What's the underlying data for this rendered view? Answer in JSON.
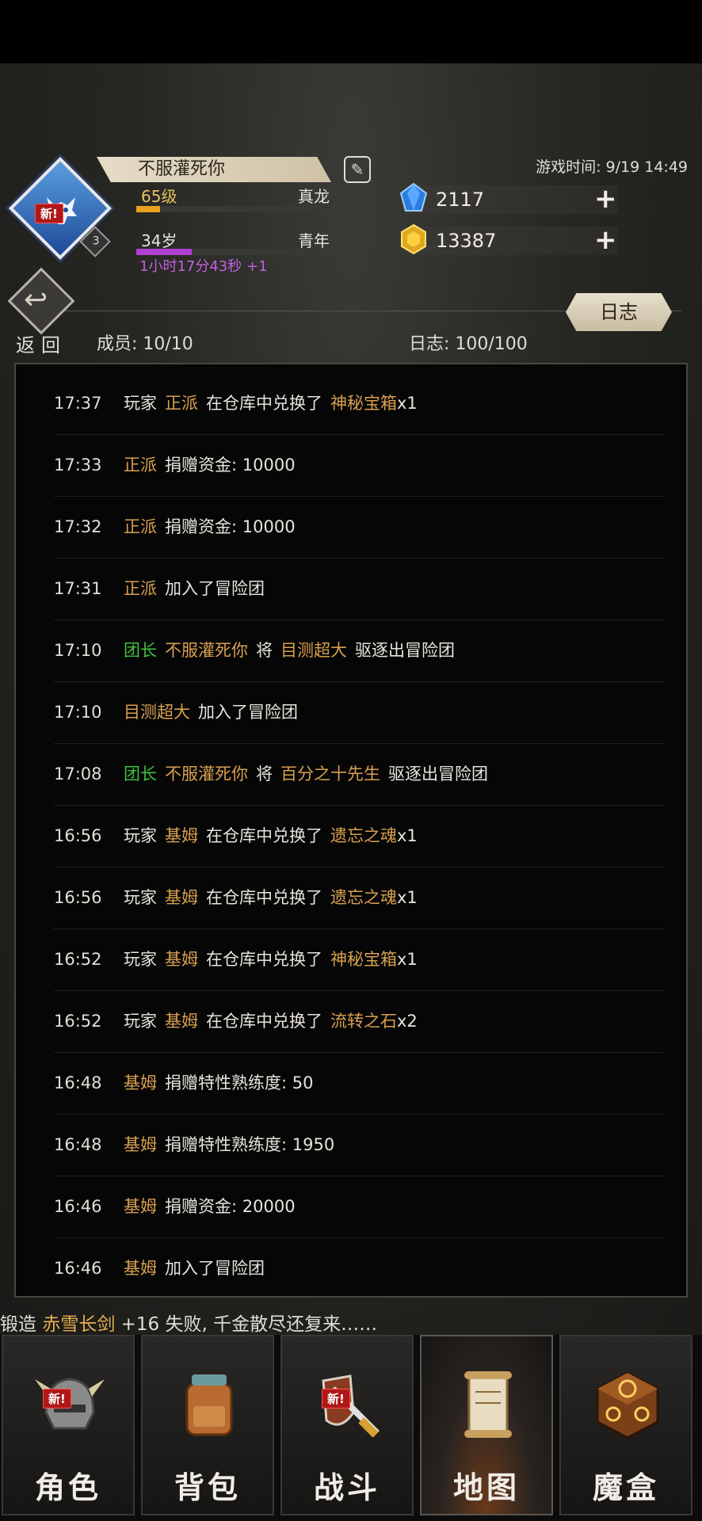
{
  "profile": {
    "name": "不服灌死你",
    "badge": "新!",
    "small_level": "3",
    "level_left": "65级",
    "level_right": "真龙",
    "level_progress": 0.12,
    "age_left": "34岁",
    "age_right": "青年",
    "age_progress": 0.28,
    "timer": "1小时17分43秒 +1"
  },
  "game_time": "游戏时间: 9/19 14:49",
  "currency": {
    "diamonds": "2117",
    "gold": "13387"
  },
  "toolbar": {
    "back_label": "返回",
    "log_button": "日志",
    "members": "成员: 10/10",
    "log_count": "日志: 100/100"
  },
  "logs": [
    {
      "time": "17:37",
      "parts": [
        {
          "t": "玩家",
          "c": "w"
        },
        {
          "t": "正派",
          "c": "o"
        },
        {
          "t": "在仓库中兑换了",
          "c": "w"
        },
        {
          "t": "神秘宝箱",
          "c": "o"
        },
        {
          "t": "x1",
          "c": "w"
        }
      ]
    },
    {
      "time": "17:33",
      "parts": [
        {
          "t": "正派",
          "c": "o"
        },
        {
          "t": "捐赠资金: 10000",
          "c": "w"
        }
      ]
    },
    {
      "time": "17:32",
      "parts": [
        {
          "t": "正派",
          "c": "o"
        },
        {
          "t": "捐赠资金: 10000",
          "c": "w"
        }
      ]
    },
    {
      "time": "17:31",
      "parts": [
        {
          "t": "正派",
          "c": "o"
        },
        {
          "t": "加入了冒险团",
          "c": "w"
        }
      ]
    },
    {
      "time": "17:10",
      "parts": [
        {
          "t": "团长",
          "c": "g"
        },
        {
          "t": "不服灌死你",
          "c": "o"
        },
        {
          "t": "将",
          "c": "w"
        },
        {
          "t": "目测超大",
          "c": "o"
        },
        {
          "t": "驱逐出冒险团",
          "c": "w"
        }
      ]
    },
    {
      "time": "17:10",
      "parts": [
        {
          "t": "目测超大",
          "c": "o"
        },
        {
          "t": "加入了冒险团",
          "c": "w"
        }
      ]
    },
    {
      "time": "17:08",
      "parts": [
        {
          "t": "团长",
          "c": "g"
        },
        {
          "t": "不服灌死你",
          "c": "o"
        },
        {
          "t": "将",
          "c": "w"
        },
        {
          "t": "百分之十先生",
          "c": "o"
        },
        {
          "t": "驱逐出冒险团",
          "c": "w"
        }
      ]
    },
    {
      "time": "16:56",
      "parts": [
        {
          "t": "玩家",
          "c": "w"
        },
        {
          "t": "基姆",
          "c": "o"
        },
        {
          "t": "在仓库中兑换了",
          "c": "w"
        },
        {
          "t": "遗忘之魂",
          "c": "o"
        },
        {
          "t": "x1",
          "c": "w"
        }
      ]
    },
    {
      "time": "16:56",
      "parts": [
        {
          "t": "玩家",
          "c": "w"
        },
        {
          "t": "基姆",
          "c": "o"
        },
        {
          "t": "在仓库中兑换了",
          "c": "w"
        },
        {
          "t": "遗忘之魂",
          "c": "o"
        },
        {
          "t": "x1",
          "c": "w"
        }
      ]
    },
    {
      "time": "16:52",
      "parts": [
        {
          "t": "玩家",
          "c": "w"
        },
        {
          "t": "基姆",
          "c": "o"
        },
        {
          "t": "在仓库中兑换了",
          "c": "w"
        },
        {
          "t": "神秘宝箱",
          "c": "o"
        },
        {
          "t": "x1",
          "c": "w"
        }
      ]
    },
    {
      "time": "16:52",
      "parts": [
        {
          "t": "玩家",
          "c": "w"
        },
        {
          "t": "基姆",
          "c": "o"
        },
        {
          "t": "在仓库中兑换了",
          "c": "w"
        },
        {
          "t": "流转之石",
          "c": "o"
        },
        {
          "t": "x2",
          "c": "w"
        }
      ]
    },
    {
      "time": "16:48",
      "parts": [
        {
          "t": "基姆",
          "c": "o"
        },
        {
          "t": "捐赠特性熟练度: 50",
          "c": "w"
        }
      ]
    },
    {
      "time": "16:48",
      "parts": [
        {
          "t": "基姆",
          "c": "o"
        },
        {
          "t": "捐赠特性熟练度: 1950",
          "c": "w"
        }
      ]
    },
    {
      "time": "16:46",
      "parts": [
        {
          "t": "基姆",
          "c": "o"
        },
        {
          "t": "捐赠资金: 20000",
          "c": "w"
        }
      ]
    },
    {
      "time": "16:46",
      "parts": [
        {
          "t": "基姆",
          "c": "o"
        },
        {
          "t": "加入了冒险团",
          "c": "w"
        }
      ]
    }
  ],
  "ticker": {
    "prefix": "锻造",
    "item": "赤雪长剑",
    "suffix": "+16 失败, 千金散尽还复来……"
  },
  "nav": [
    {
      "label": "角色",
      "icon": "helmet-icon",
      "badge": "新!"
    },
    {
      "label": "背包",
      "icon": "backpack-icon",
      "badge": ""
    },
    {
      "label": "战斗",
      "icon": "sword-shield-icon",
      "badge": "新!"
    },
    {
      "label": "地图",
      "icon": "scroll-map-icon",
      "badge": ""
    },
    {
      "label": "魔盒",
      "icon": "magic-box-icon",
      "badge": ""
    }
  ],
  "colors": {
    "orange_name": "#d8a050",
    "green_role": "#40c040",
    "level_bar": "#e8a020",
    "age_bar": "#b040d0",
    "timer": "#c060e0"
  }
}
